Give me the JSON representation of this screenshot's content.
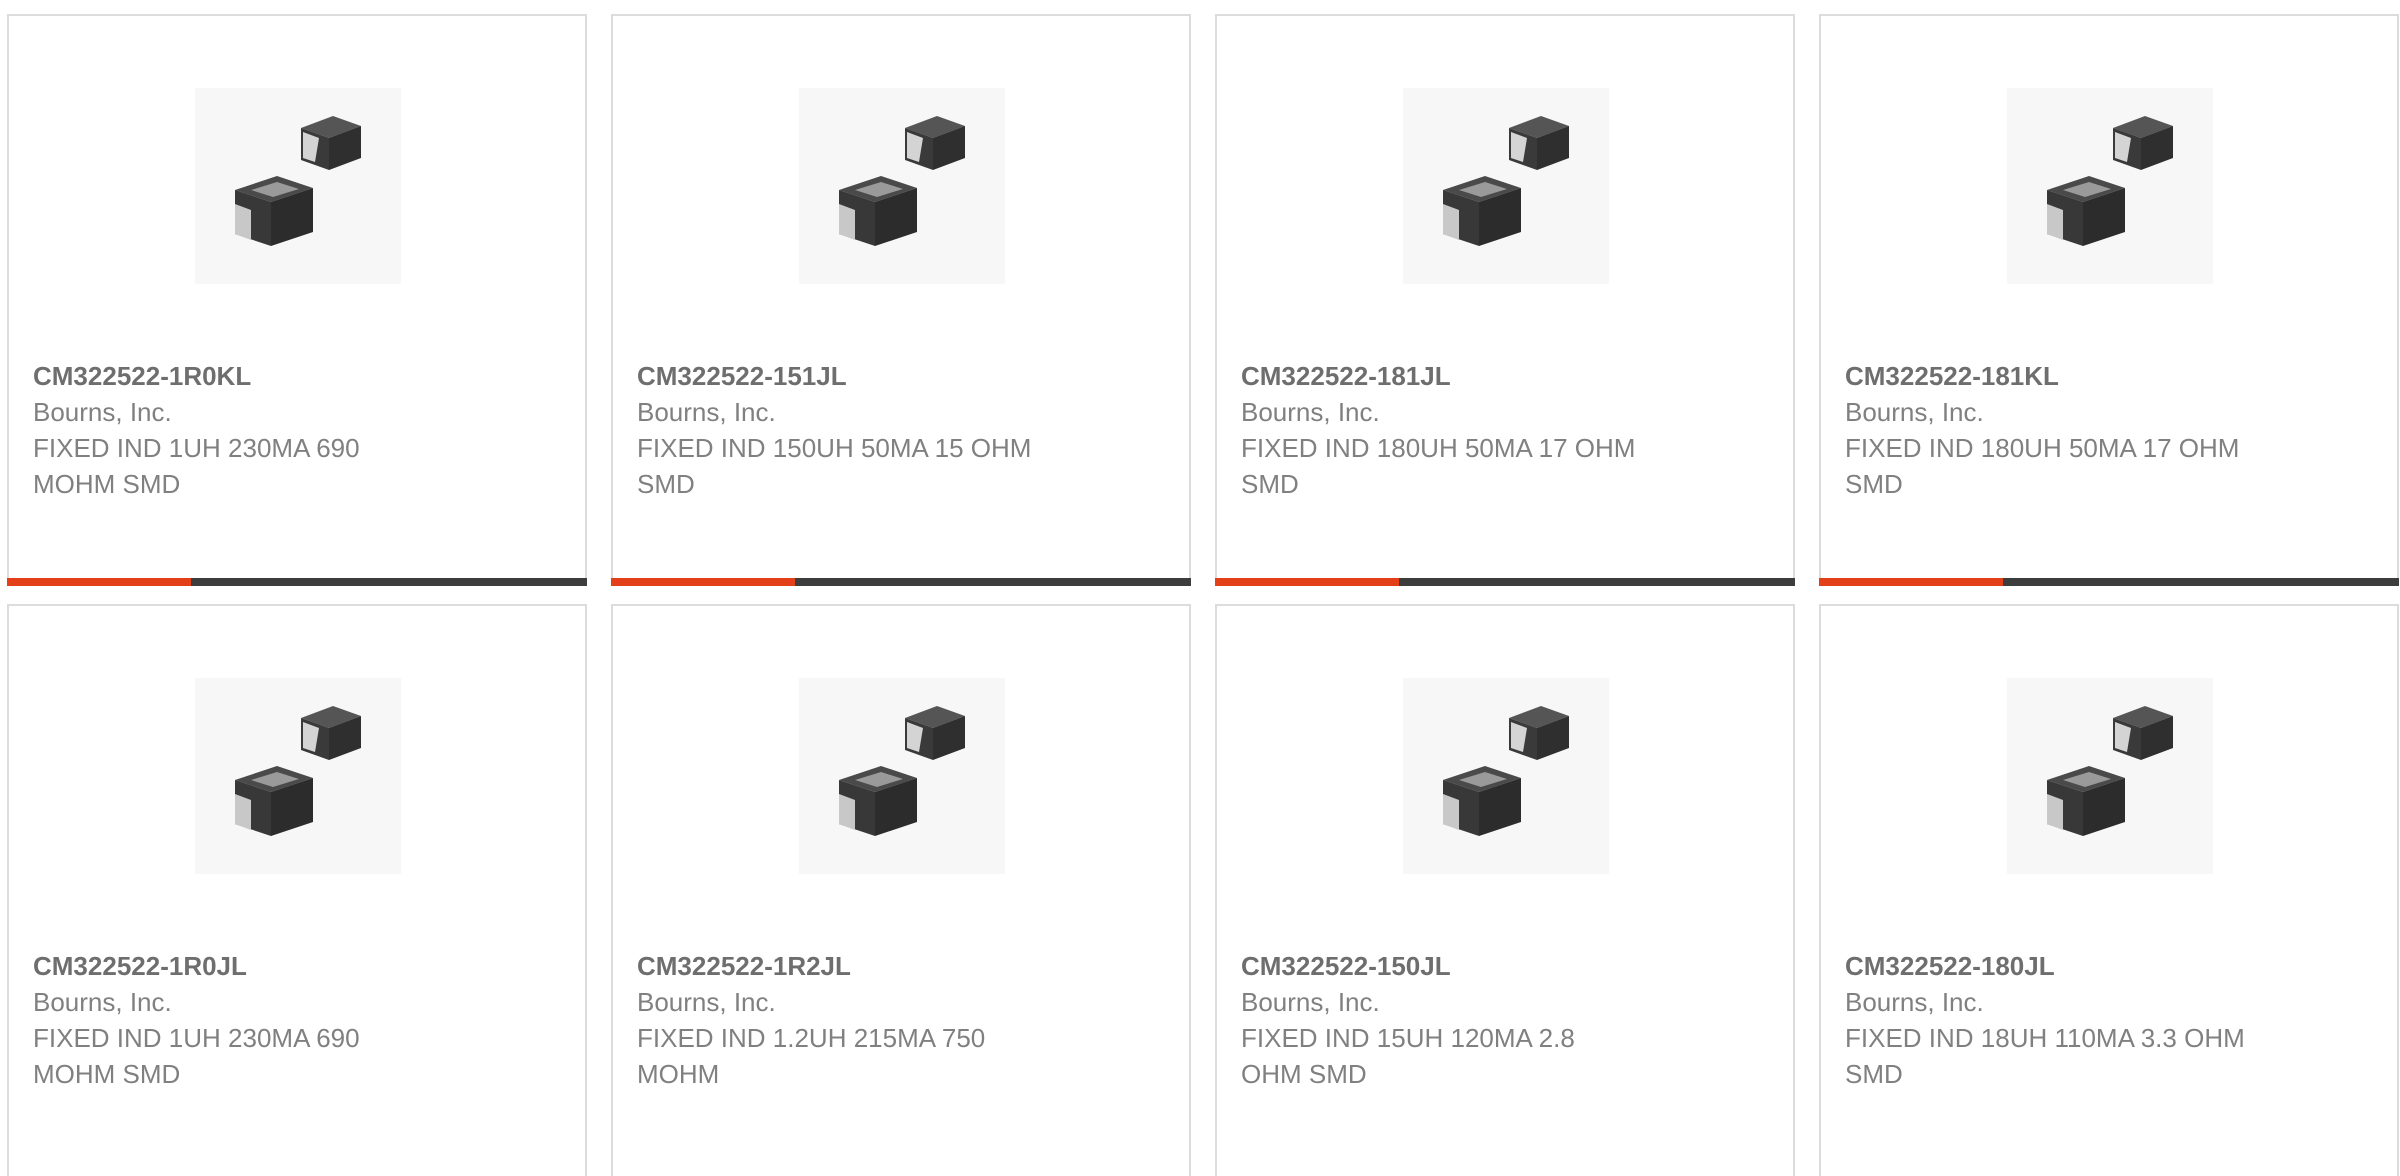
{
  "colors": {
    "accent": "#e3401a",
    "bar_dark": "#3d3d3d",
    "card_border": "#dcdcdc"
  },
  "products": [
    {
      "part_number": "CM322522-1R0KL",
      "manufacturer": "Bourns, Inc.",
      "description": "FIXED IND 1UH 230MA 690 MOHM SMD",
      "image_icon": "smd-inductor-image"
    },
    {
      "part_number": "CM322522-151JL",
      "manufacturer": "Bourns, Inc.",
      "description": "FIXED IND 150UH 50MA 15 OHM SMD",
      "image_icon": "smd-inductor-image"
    },
    {
      "part_number": "CM322522-181JL",
      "manufacturer": "Bourns, Inc.",
      "description": "FIXED IND 180UH 50MA 17 OHM SMD",
      "image_icon": "smd-inductor-image"
    },
    {
      "part_number": "CM322522-181KL",
      "manufacturer": "Bourns, Inc.",
      "description": "FIXED IND 180UH 50MA 17 OHM SMD",
      "image_icon": "smd-inductor-image"
    },
    {
      "part_number": "CM322522-1R0JL",
      "manufacturer": "Bourns, Inc.",
      "description": "FIXED IND 1UH 230MA 690 MOHM SMD",
      "image_icon": "smd-inductor-image"
    },
    {
      "part_number": "CM322522-1R2JL",
      "manufacturer": "Bourns, Inc.",
      "description": "FIXED IND 1.2UH 215MA 750 MOHM",
      "image_icon": "smd-inductor-image"
    },
    {
      "part_number": "CM322522-150JL",
      "manufacturer": "Bourns, Inc.",
      "description": "FIXED IND 15UH 120MA 2.8 OHM SMD",
      "image_icon": "smd-inductor-image"
    },
    {
      "part_number": "CM322522-180JL",
      "manufacturer": "Bourns, Inc.",
      "description": "FIXED IND 18UH 110MA 3.3 OHM SMD",
      "image_icon": "smd-inductor-image"
    }
  ]
}
